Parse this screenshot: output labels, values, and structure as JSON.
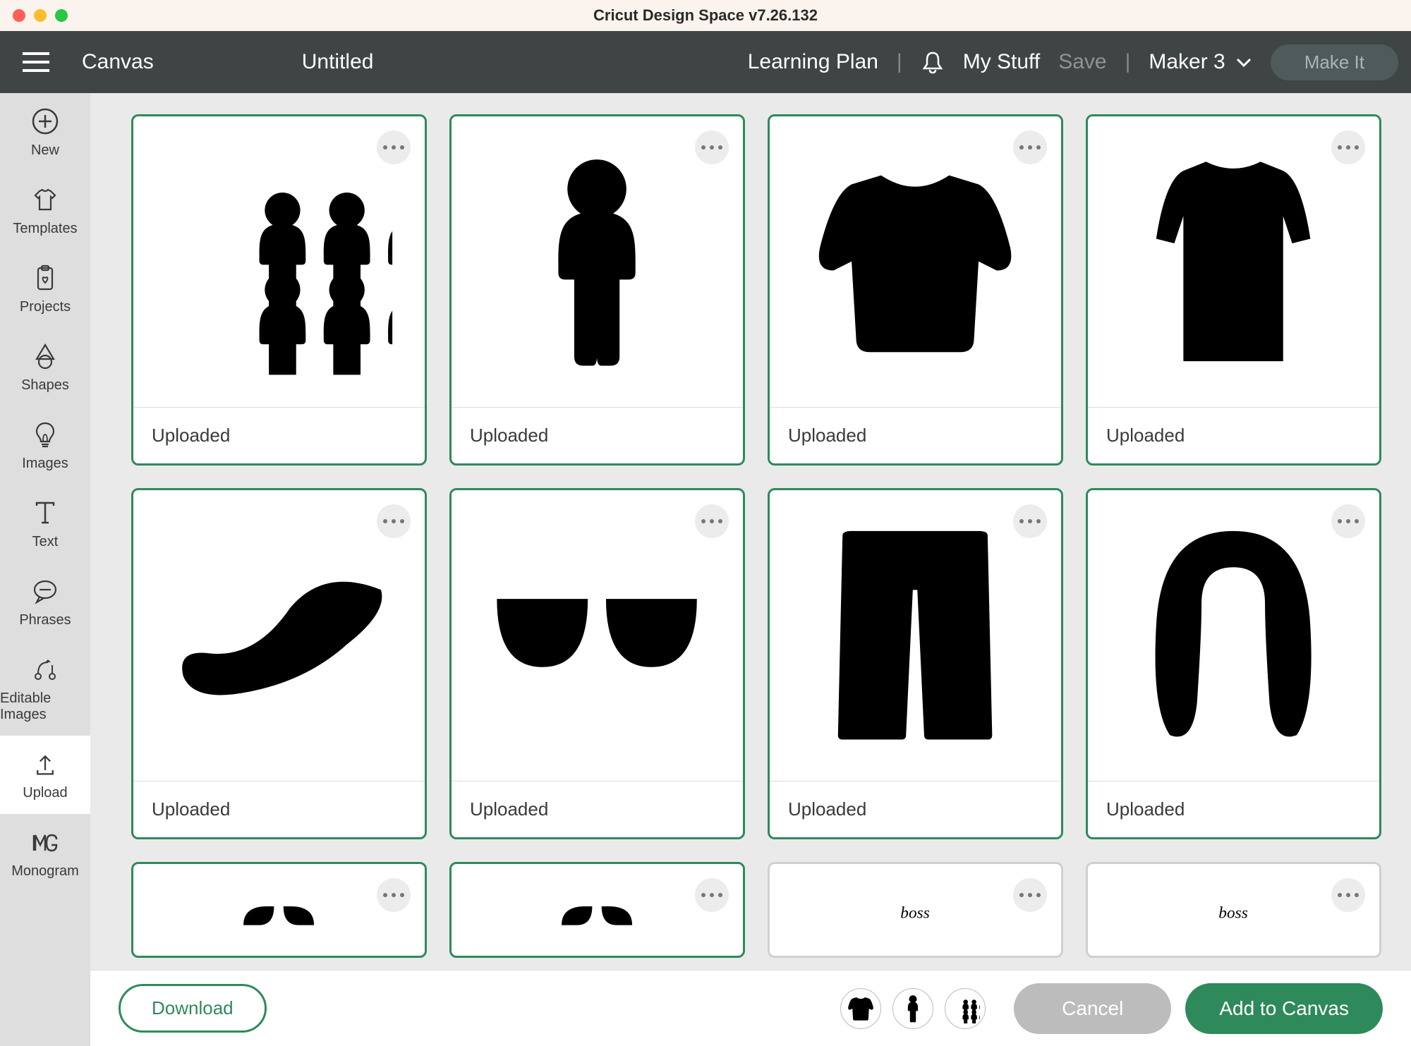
{
  "window": {
    "title": "Cricut Design Space  v7.26.132"
  },
  "header": {
    "canvas": "Canvas",
    "project_title": "Untitled",
    "learning_plan": "Learning Plan",
    "my_stuff": "My Stuff",
    "save": "Save",
    "machine": "Maker 3",
    "make_it": "Make It"
  },
  "sidebar": {
    "items": [
      {
        "label": "New",
        "icon": "plus-circle"
      },
      {
        "label": "Templates",
        "icon": "tshirt"
      },
      {
        "label": "Projects",
        "icon": "clipboard-heart"
      },
      {
        "label": "Shapes",
        "icon": "shapes"
      },
      {
        "label": "Images",
        "icon": "lightbulb"
      },
      {
        "label": "Text",
        "icon": "text-t"
      },
      {
        "label": "Phrases",
        "icon": "speech-bubble"
      },
      {
        "label": "Editable Images",
        "icon": "node-edit"
      },
      {
        "label": "Upload",
        "icon": "upload-arrow"
      },
      {
        "label": "Monogram",
        "icon": "monogram-mg"
      }
    ],
    "active_index": 8
  },
  "cards": [
    {
      "label": "Uploaded",
      "shape": "people-group",
      "selected": true
    },
    {
      "label": "Uploaded",
      "shape": "person",
      "selected": true
    },
    {
      "label": "Uploaded",
      "shape": "shirt",
      "selected": true
    },
    {
      "label": "Uploaded",
      "shape": "dress",
      "selected": true
    },
    {
      "label": "Uploaded",
      "shape": "mustache-curl",
      "selected": true
    },
    {
      "label": "Uploaded",
      "shape": "sunglasses",
      "selected": true
    },
    {
      "label": "Uploaded",
      "shape": "pants",
      "selected": true
    },
    {
      "label": "Uploaded",
      "shape": "hair-long",
      "selected": true
    },
    {
      "label": "",
      "shape": "partial",
      "selected": true
    },
    {
      "label": "",
      "shape": "partial",
      "selected": true
    },
    {
      "label": "",
      "shape": "partial-text",
      "selected": false
    },
    {
      "label": "",
      "shape": "partial-text",
      "selected": false
    }
  ],
  "selected_thumbs": [
    "shirt",
    "person",
    "people-group"
  ],
  "bottombar": {
    "download": "Download",
    "cancel": "Cancel",
    "add": "Add to Canvas"
  }
}
